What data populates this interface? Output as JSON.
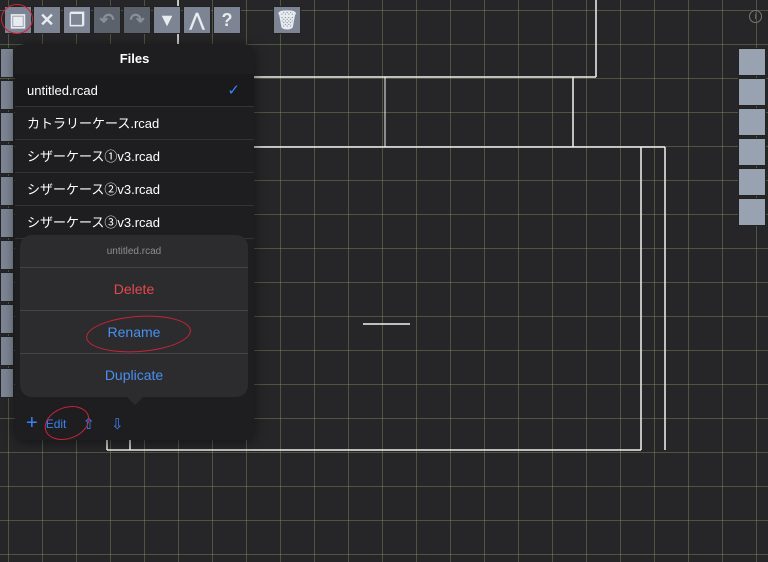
{
  "toolbar": {
    "items": [
      "files-icon",
      "tools-icon",
      "copy-icon",
      "undo-icon",
      "redo-icon",
      "dropdown-icon",
      "terrain-icon",
      "help-icon",
      "trash-icon"
    ],
    "help_label": "?"
  },
  "snap_toolbar": {
    "items": [
      "grid-snap-icon",
      "endpoint-snap-icon",
      "center-snap-icon",
      "intersection-snap-icon",
      "perpendicular-snap-icon",
      "tangent-snap-icon"
    ]
  },
  "info_label": "i",
  "files": {
    "title": "Files",
    "items": [
      {
        "name": "untitled.rcad",
        "selected": true
      },
      {
        "name": "カトラリーケース.rcad"
      },
      {
        "name": "シザーケース①v3.rcad"
      },
      {
        "name": "シザーケース②v3.rcad"
      },
      {
        "name": "シザーケース③v3.rcad"
      }
    ],
    "check": "✓"
  },
  "action_sheet": {
    "title": "untitled.rcad",
    "delete": "Delete",
    "rename": "Rename",
    "duplicate": "Duplicate"
  },
  "footer": {
    "add": "+",
    "edit": "Edit"
  },
  "colors": {
    "accent": "#3b82f6",
    "destructive": "#e5484d",
    "annotation": "#c8243a"
  }
}
